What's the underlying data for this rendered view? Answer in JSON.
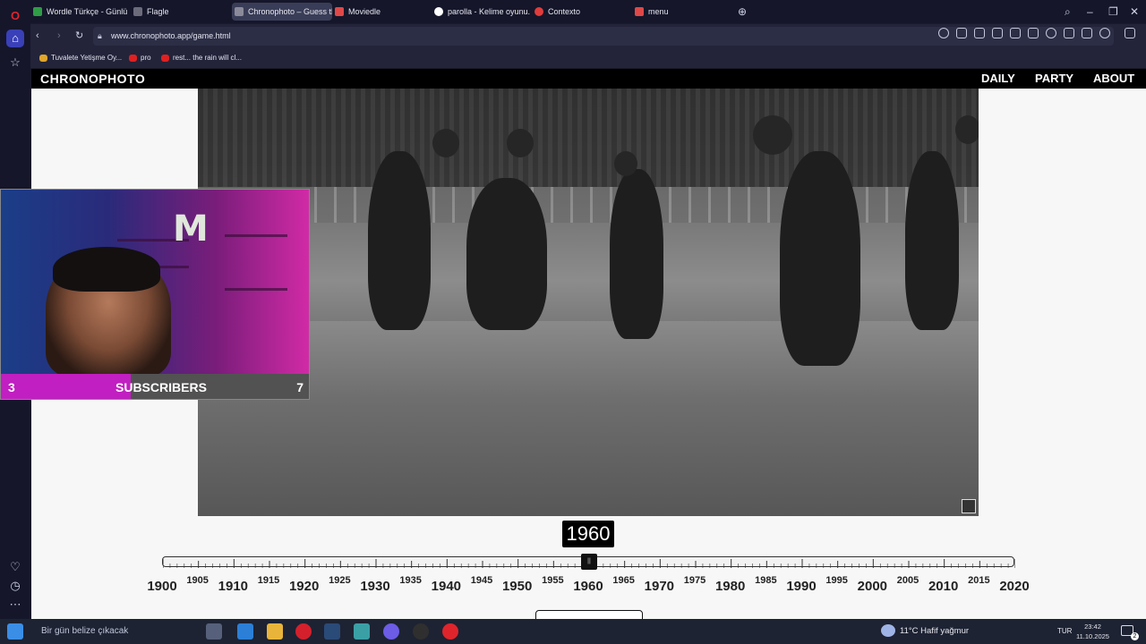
{
  "browser": {
    "tabs": [
      {
        "label": "Wordle Türkçe - Günlük K",
        "favicon_color": "#2e9d45"
      },
      {
        "label": "Flagle",
        "favicon_color": "#6b6b7b"
      },
      {
        "label": "Chronophoto – Guess the",
        "favicon_color": "#6b6b7b",
        "active": true
      },
      {
        "label": "Moviedle",
        "favicon_color": "#e04848"
      },
      {
        "label": "parolla - Kelime oyunu. Gü",
        "favicon_color": "#ffffff"
      },
      {
        "label": "Contexto",
        "favicon_color": "#e03c3c"
      },
      {
        "label": "menu",
        "favicon_color": "#e04848"
      }
    ],
    "url": "www.chronophoto.app/game.html",
    "bookmarks": [
      {
        "label": "Tuvalete Yetişme Oy...",
        "color": "#e0a52a"
      },
      {
        "label": "pro",
        "color": "#e02020"
      },
      {
        "label": "rest... the rain will cl...",
        "color": "#e02020"
      }
    ]
  },
  "site": {
    "logo": "CHRONOPHOTO",
    "nav": [
      "DAILY",
      "PARTY",
      "ABOUT"
    ],
    "current_year": "1960",
    "slider": {
      "min": 1900,
      "max": 2020,
      "value": 1960
    },
    "major_ticks": [
      "1900",
      "1910",
      "1920",
      "1930",
      "1940",
      "1950",
      "1960",
      "1970",
      "1980",
      "1990",
      "2000",
      "2010",
      "2020"
    ],
    "minor_ticks": [
      "1905",
      "1915",
      "1925",
      "1935",
      "1945",
      "1955",
      "1965",
      "1975",
      "1985",
      "1995",
      "2005",
      "2015"
    ]
  },
  "webcam": {
    "subs_left": "3",
    "subs_label": "SUBSCRIBERS",
    "subs_right": "7",
    "progress": 0.42
  },
  "taskbar": {
    "search_text": "Bir gün belize çıkacak",
    "weather": "11°C  Hafif yağmur",
    "language": "TUR",
    "time": "23:42",
    "date": "11.10.2025",
    "notifications": "2"
  }
}
